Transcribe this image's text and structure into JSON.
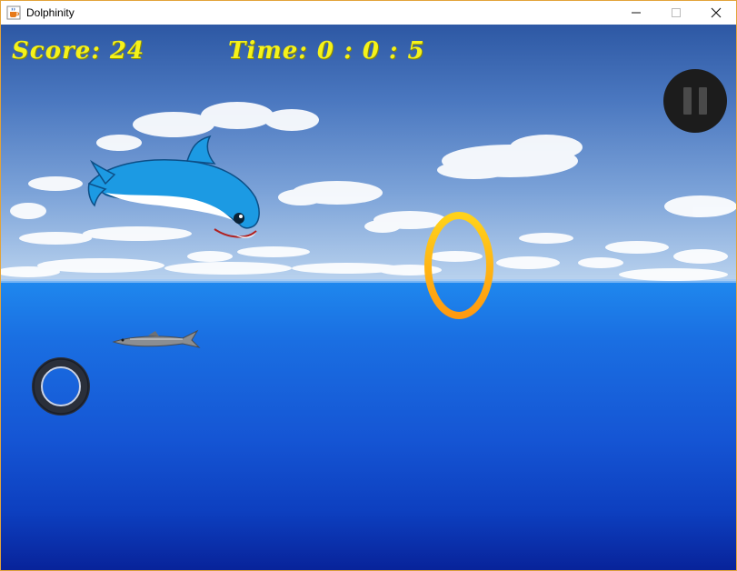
{
  "window": {
    "title": "Dolphinity",
    "controls": [
      "minimize",
      "maximize",
      "close"
    ]
  },
  "hud": {
    "score_label": "Score: 24",
    "time_label": "Time: 0 : 0 : 5"
  },
  "icons": {
    "app": "java-cup-icon",
    "pause": "pause-icon"
  },
  "colors": {
    "hud_text": "#f5f21a",
    "ring_top": "#ffd21a",
    "ring_bottom": "#ff9a10",
    "pause_bg": "#1c1c1c"
  }
}
